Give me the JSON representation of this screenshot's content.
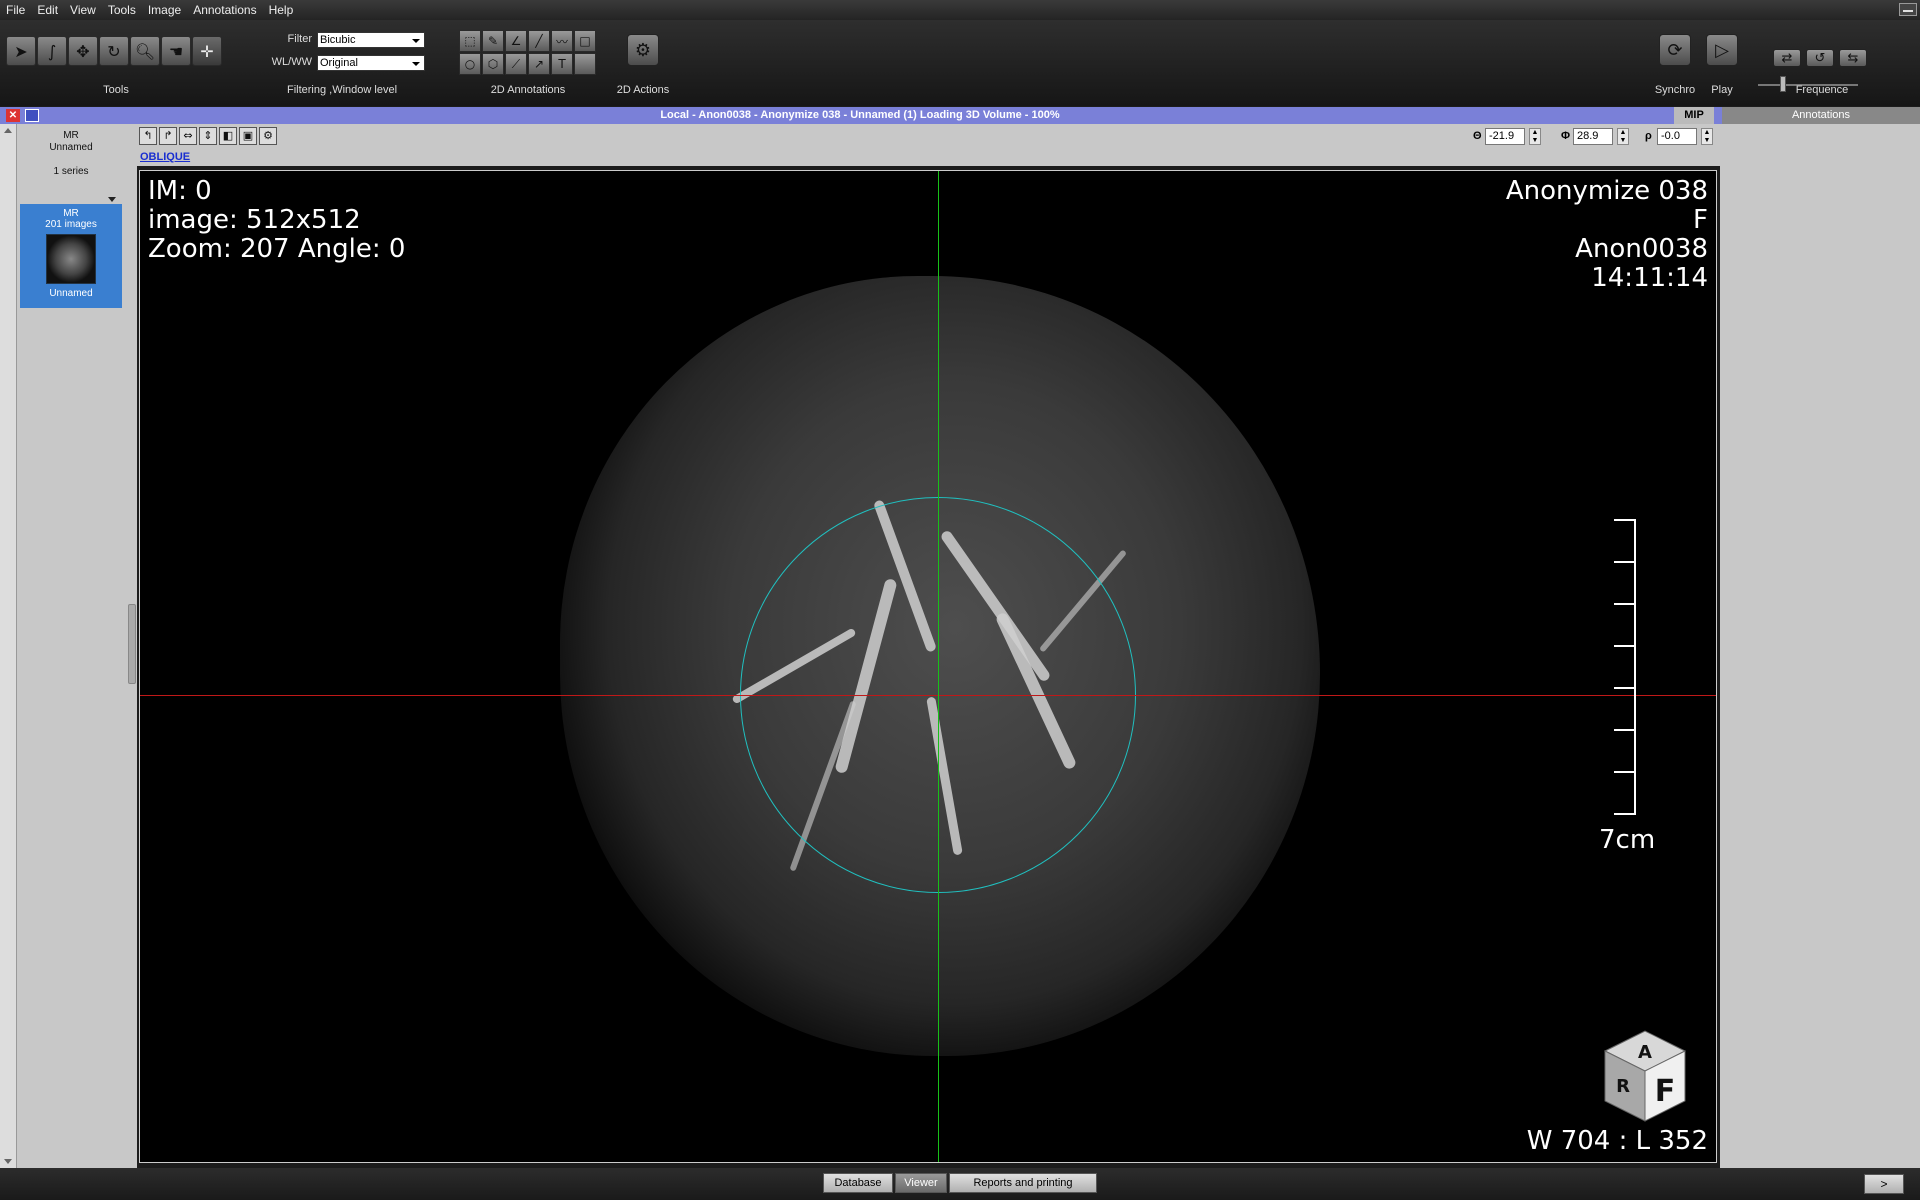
{
  "menu": [
    "File",
    "Edit",
    "View",
    "Tools",
    "Image",
    "Annotations",
    "Help"
  ],
  "toolbar": {
    "groups": {
      "tools": "Tools",
      "filtering": "Filtering ,Window level",
      "annotations": "2D Annotations",
      "actions": "2D Actions",
      "synchro": "Synchro",
      "play": "Play",
      "frequence": "Frequence"
    },
    "filter_label": "Filter",
    "filter_value": "Bicubic",
    "wlww_label": "WL/WW",
    "wlww_value": "Original"
  },
  "window": {
    "title": "Local - Anon0038 - Anonymize 038 - Unnamed (1) Loading 3D Volume - 100%",
    "mip_tab": "MIP",
    "annotations_tab": "Annotations"
  },
  "study": {
    "modality": "MR",
    "name": "Unnamed",
    "series_count": "1 series"
  },
  "series": {
    "modality": "MR",
    "images": "201 images",
    "name": "Unnamed"
  },
  "viewer": {
    "mode_link": "OBLIQUE",
    "theta_label": "Θ",
    "theta_value": "-21.9",
    "phi_label": "Φ",
    "phi_value": "28.9",
    "rho_label": "ρ",
    "rho_value": "-0.0"
  },
  "overlay": {
    "im": "IM: 0",
    "image_size": "image: 512x512",
    "zoom_angle": "Zoom: 207 Angle: 0",
    "patient_name": "Anonymize 038",
    "sex": "F",
    "patient_id": "Anon0038",
    "time": "14:11:14",
    "scale": "7cm",
    "window_level": "W 704 : L 352",
    "cube_front": "F",
    "cube_top": "A",
    "cube_side": "R"
  },
  "bottom_tabs": {
    "database": "Database",
    "viewer": "Viewer",
    "reports": "Reports and printing",
    "next": ">"
  },
  "colors": {
    "title_bar": "#7a80d8",
    "series_selected": "#3a7fd0",
    "crosshair_horizontal": "#c01818",
    "crosshair_vertical": "#18c018",
    "roi_circle": "#20c0c0"
  }
}
